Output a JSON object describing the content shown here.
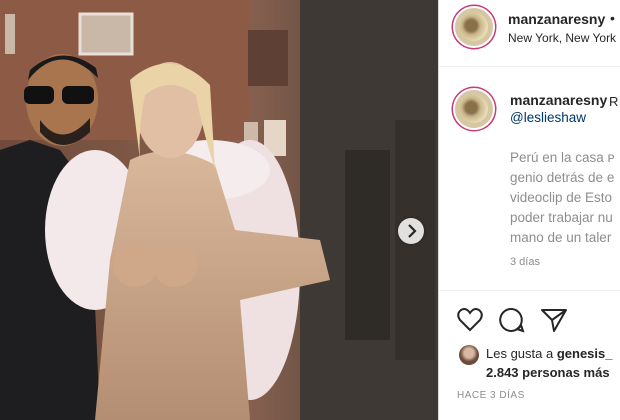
{
  "header": {
    "username": "manzanaresny",
    "dot": "•",
    "location": "New York, New York"
  },
  "caption": {
    "username": "manzanaresny",
    "username_suffix": "R",
    "mention": "@leslieshaw",
    "lines": [
      "Perú en la casa ᴘ",
      "genio detrás de e",
      "videoclip de Esto",
      "poder trabajar nu",
      "mano de un taler"
    ],
    "time": "3 días"
  },
  "actions": {
    "like_icon": "heart-icon",
    "comment_icon": "comment-icon",
    "share_icon": "paper-plane-icon"
  },
  "likes": {
    "prefix": "Les gusta a ",
    "user": "genesis_",
    "count_line": "2.843 personas más"
  },
  "post_age": "HACE 3 DÍAS",
  "photo": {
    "next_icon": "chevron-right-icon"
  }
}
